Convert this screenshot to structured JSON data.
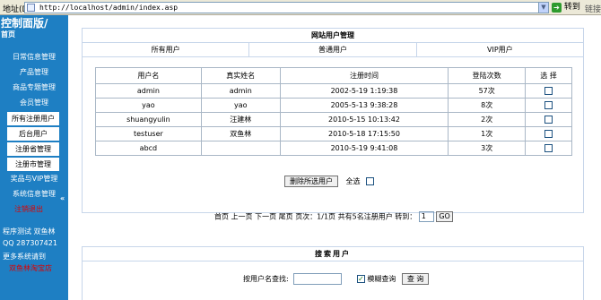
{
  "browser": {
    "address_label": "地址(D)",
    "url": "http://localhost/admin/index.asp",
    "go_label": "转到",
    "links_label": "链接"
  },
  "sidebar": {
    "title": "控制面版/",
    "home": "首页",
    "items": [
      {
        "label": "日常信息管理",
        "boxed": false
      },
      {
        "label": "产品管理",
        "boxed": false
      },
      {
        "label": "商品专题管理",
        "boxed": false
      },
      {
        "label": "会员管理",
        "boxed": false
      },
      {
        "label": "所有注册用户",
        "boxed": true
      },
      {
        "label": "后台用户",
        "boxed": true
      },
      {
        "label": "注册省管理",
        "boxed": true
      },
      {
        "label": "注册市管理",
        "boxed": true
      },
      {
        "label": "奖品与VIP管理",
        "boxed": false
      },
      {
        "label": "系统信息管理",
        "boxed": false
      }
    ],
    "collapse": "«",
    "red_link_1": "注销退出",
    "program_test": "程序测试 双鱼林",
    "qq": "QQ 287307421",
    "more": "更多系统请到",
    "red_link_2": "双鱼林淘宝店"
  },
  "panel": {
    "title": "网站用户管理",
    "tabs": [
      "所有用户",
      "普通用户",
      "VIP用户"
    ]
  },
  "table": {
    "headers": [
      "用户名",
      "真实姓名",
      "注册时间",
      "登陆次数",
      "选 择"
    ],
    "rows": [
      {
        "username": "admin",
        "realname": "admin",
        "time": "2002-5-19 1:19:38",
        "logins": "57次"
      },
      {
        "username": "yao",
        "realname": "yao",
        "time": "2005-5-13 9:38:28",
        "logins": "8次"
      },
      {
        "username": "shuangyulin",
        "realname": "汪建林",
        "time": "2010-5-15 10:13:42",
        "logins": "2次"
      },
      {
        "username": "testuser",
        "realname": "双鱼林",
        "time": "2010-5-18 17:15:50",
        "logins": "1次"
      },
      {
        "username": "abcd",
        "realname": "",
        "time": "2010-5-19 9:41:08",
        "logins": "3次"
      }
    ]
  },
  "actions": {
    "delete_selected": "删除所选用户",
    "select_all": "全选"
  },
  "pager": {
    "first": "首页",
    "prev": "上一页",
    "next": "下一页",
    "last": "尾页",
    "page_info": "页次：1/1页",
    "total": "共有5名注册用户",
    "goto_label": "转到：",
    "page_value": "1",
    "go": "GO"
  },
  "search": {
    "title": "搜索用户",
    "label": "按用户名查找:",
    "value": "",
    "fuzzy_label": "模糊查询",
    "fuzzy_checked": true,
    "button": "查 询"
  }
}
